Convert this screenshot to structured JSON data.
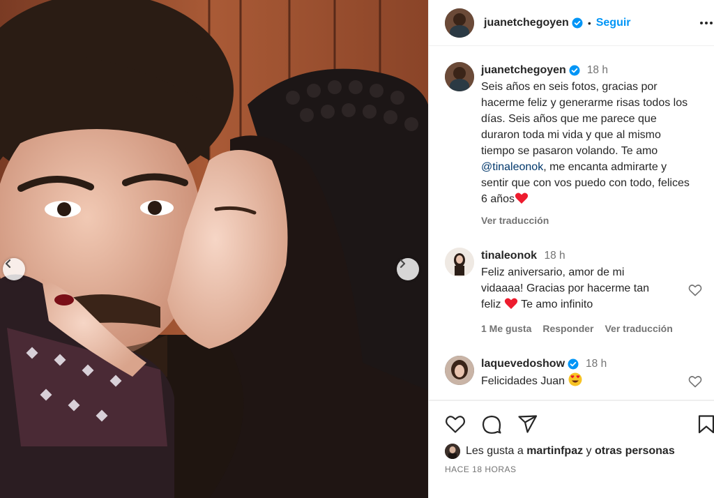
{
  "post": {
    "username": "juanetchegoyen",
    "follow_label": "Seguir",
    "dot": "•"
  },
  "caption": {
    "username": "juanetchegoyen",
    "time": "18 h",
    "text_before_mention": "Seis años en seis fotos, gracias por hacerme feliz y generarme risas todos los días. Seis años que me parece que duraron toda mi vida y que al mismo tiempo se pasaron volando. Te amo",
    "mention": "@tinaleonok",
    "text_after_mention": ", me encanta admirarte y sentir que con vos puedo con todo, felices 6 años",
    "translate_label": "Ver traducción"
  },
  "comments": [
    {
      "username": "tinaleonok",
      "time": "18 h",
      "text_a": "Feliz aniversario, amor de mi vidaaaa! Gracias por hacerme tan feliz",
      "text_b": "Te amo infinito",
      "likes": "1 Me gusta",
      "reply_label": "Responder",
      "translate_label": "Ver traducción"
    },
    {
      "username": "laquevedoshow",
      "time": "18 h",
      "text": "Felicidades Juan"
    }
  ],
  "likes": {
    "prefix": "Les gusta a",
    "user": "martinfpaz",
    "joiner": "y",
    "others": "otras personas"
  },
  "timeago": "HACE 18 HORAS",
  "colors": {
    "accent": "#0095f6",
    "verified": "#0095f6",
    "heart": "#ed4956",
    "text": "#262626",
    "muted": "#737373"
  },
  "icons": {
    "like": "heart-outline-icon",
    "comment": "comment-bubble-icon",
    "share": "paper-plane-icon",
    "save": "bookmark-icon",
    "more": "more-horizontal-icon",
    "prev": "chevron-left-icon",
    "next": "chevron-right-icon"
  }
}
